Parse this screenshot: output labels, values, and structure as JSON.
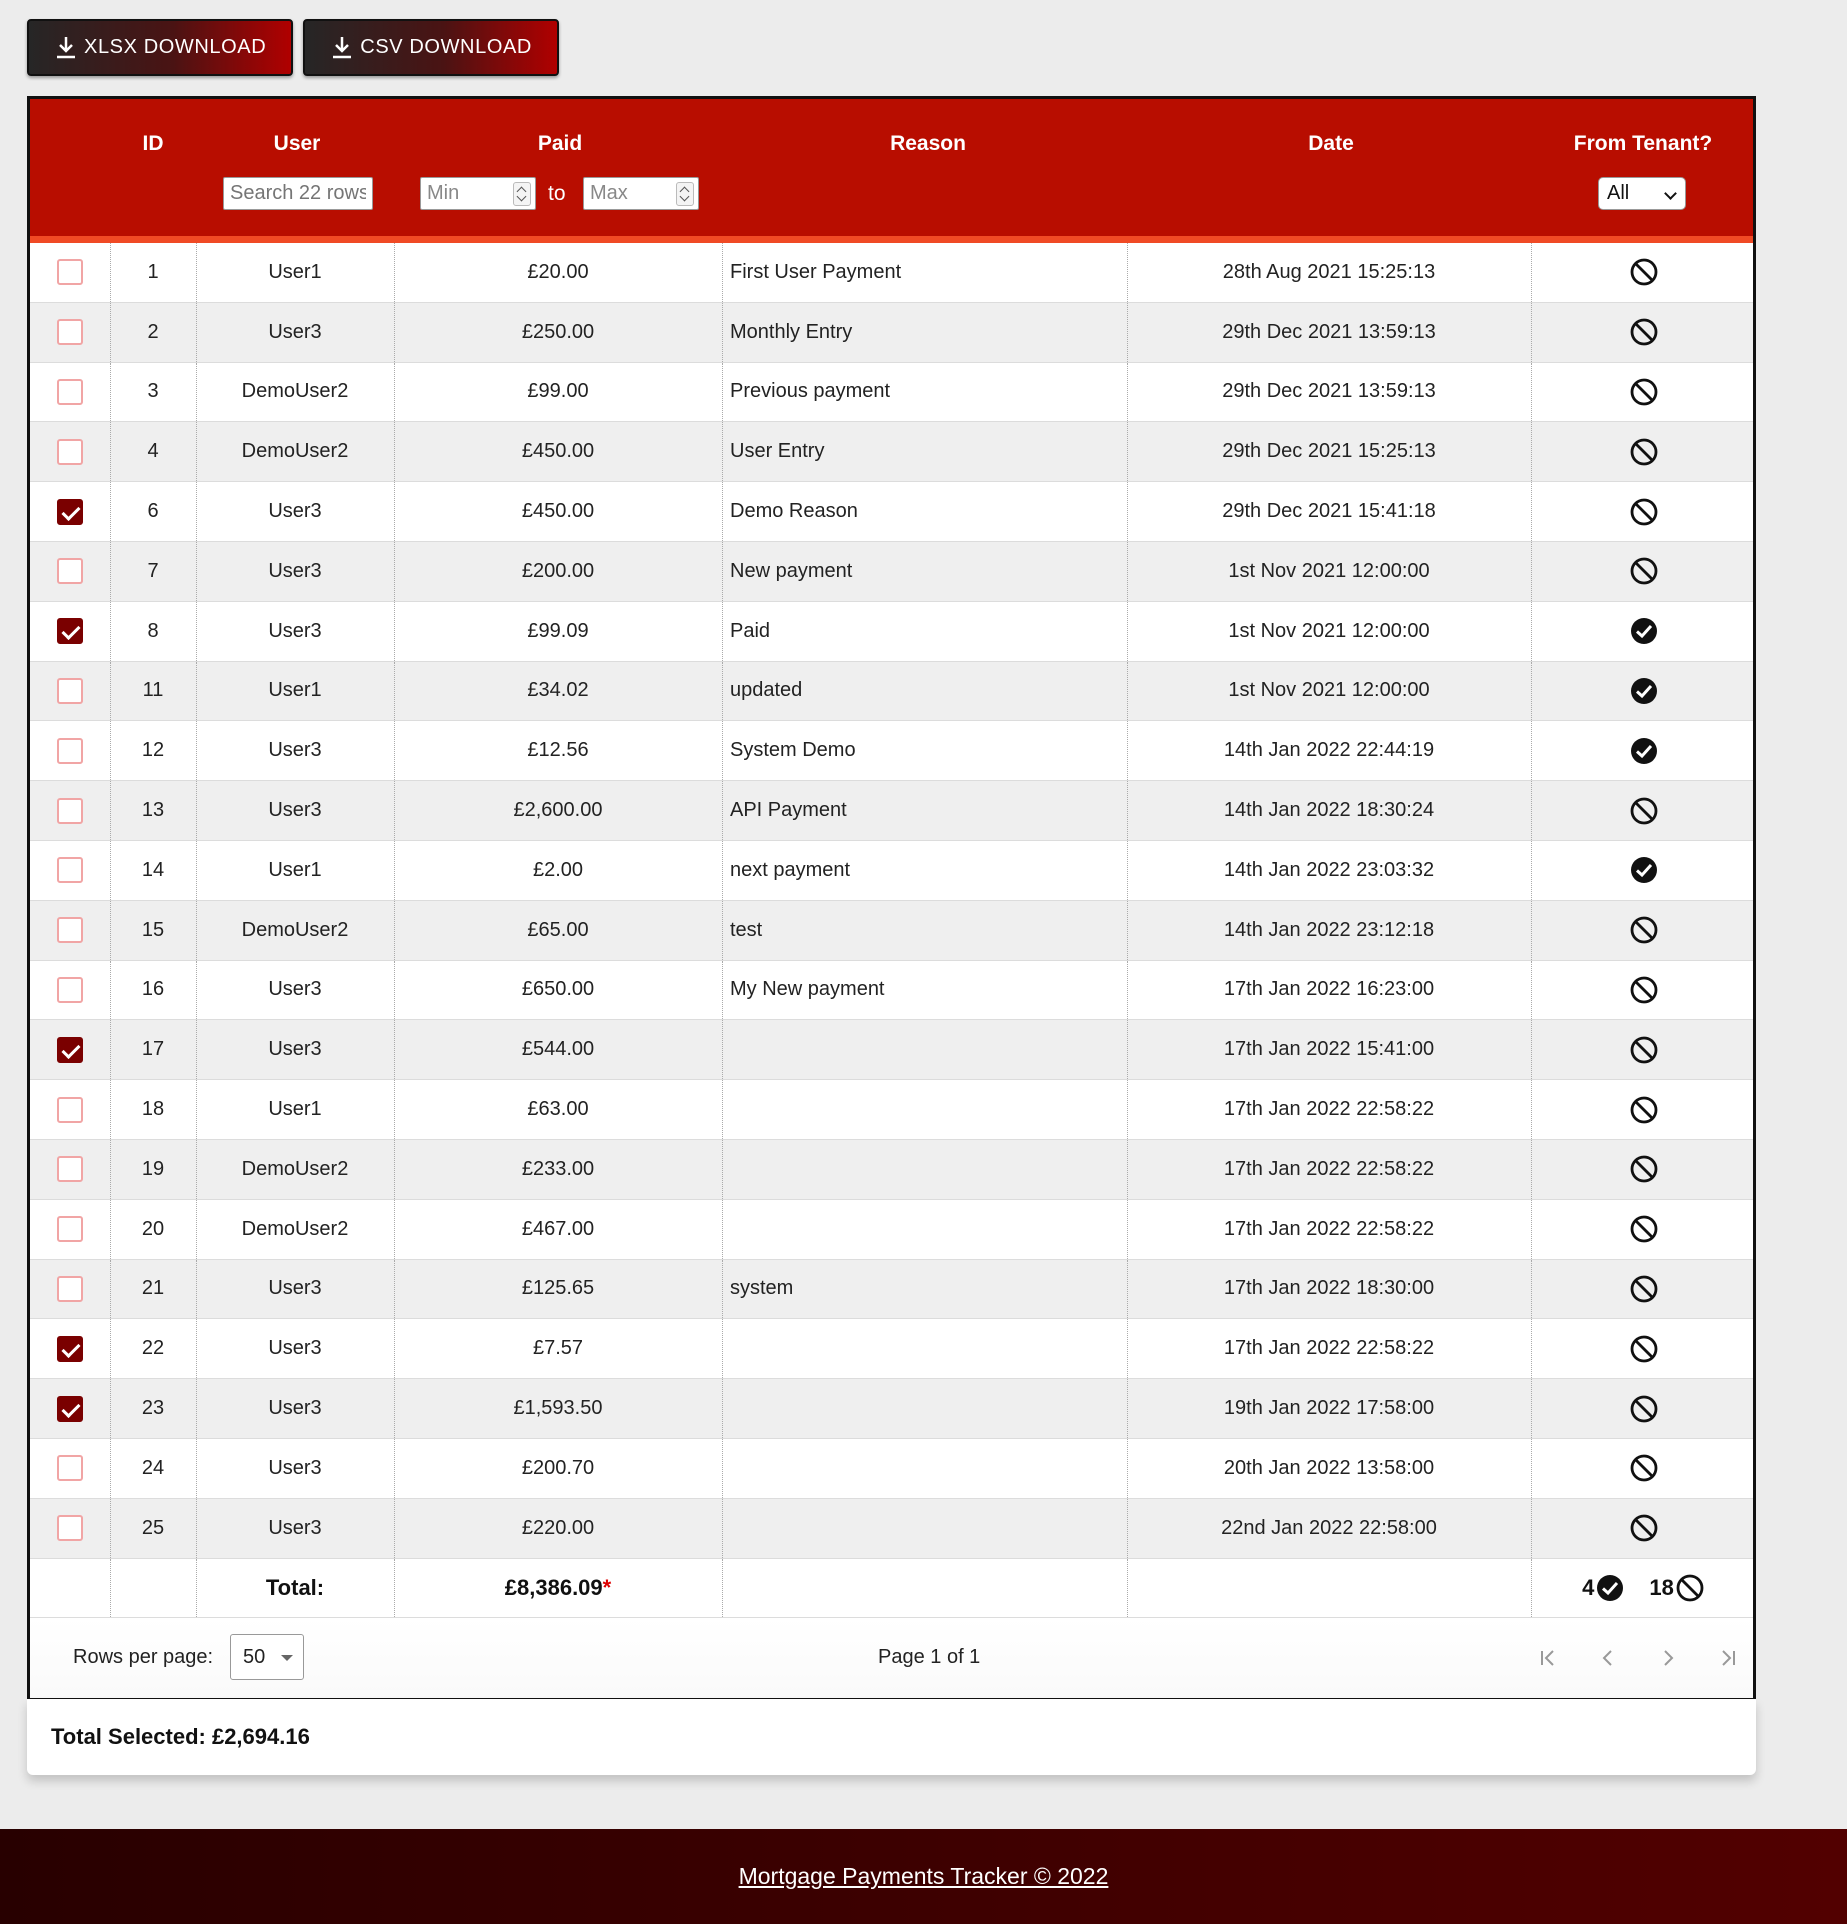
{
  "toolbar": {
    "xlsx_label": "XLSX DOWNLOAD",
    "csv_label": "CSV DOWNLOAD"
  },
  "table": {
    "headers": {
      "id": "ID",
      "user": "User",
      "paid": "Paid",
      "reason": "Reason",
      "date": "Date",
      "tenant": "From Tenant?"
    },
    "filters": {
      "user_placeholder": "Search 22 rows",
      "min_placeholder": "Min",
      "to_label": "to",
      "max_placeholder": "Max",
      "tenant_selected": "All"
    },
    "rows": [
      {
        "checked": false,
        "id": "1",
        "user": "User1",
        "paid": "£20.00",
        "reason": "First User Payment",
        "date": "28th Aug 2021 15:25:13",
        "tenant": false
      },
      {
        "checked": false,
        "id": "2",
        "user": "User3",
        "paid": "£250.00",
        "reason": "Monthly Entry",
        "date": "29th Dec 2021 13:59:13",
        "tenant": false
      },
      {
        "checked": false,
        "id": "3",
        "user": "DemoUser2",
        "paid": "£99.00",
        "reason": "Previous payment",
        "date": "29th Dec 2021 13:59:13",
        "tenant": false
      },
      {
        "checked": false,
        "id": "4",
        "user": "DemoUser2",
        "paid": "£450.00",
        "reason": "User Entry",
        "date": "29th Dec 2021 15:25:13",
        "tenant": false
      },
      {
        "checked": true,
        "id": "6",
        "user": "User3",
        "paid": "£450.00",
        "reason": "Demo Reason",
        "date": "29th Dec 2021 15:41:18",
        "tenant": false
      },
      {
        "checked": false,
        "id": "7",
        "user": "User3",
        "paid": "£200.00",
        "reason": "New payment",
        "date": "1st Nov 2021 12:00:00",
        "tenant": false
      },
      {
        "checked": true,
        "id": "8",
        "user": "User3",
        "paid": "£99.09",
        "reason": "Paid",
        "date": "1st Nov 2021 12:00:00",
        "tenant": true
      },
      {
        "checked": false,
        "id": "11",
        "user": "User1",
        "paid": "£34.02",
        "reason": "updated",
        "date": "1st Nov 2021 12:00:00",
        "tenant": true
      },
      {
        "checked": false,
        "id": "12",
        "user": "User3",
        "paid": "£12.56",
        "reason": "System Demo",
        "date": "14th Jan 2022 22:44:19",
        "tenant": true
      },
      {
        "checked": false,
        "id": "13",
        "user": "User3",
        "paid": "£2,600.00",
        "reason": "API Payment",
        "date": "14th Jan 2022 18:30:24",
        "tenant": false
      },
      {
        "checked": false,
        "id": "14",
        "user": "User1",
        "paid": "£2.00",
        "reason": "next payment",
        "date": "14th Jan 2022 23:03:32",
        "tenant": true
      },
      {
        "checked": false,
        "id": "15",
        "user": "DemoUser2",
        "paid": "£65.00",
        "reason": "test",
        "date": "14th Jan 2022 23:12:18",
        "tenant": false
      },
      {
        "checked": false,
        "id": "16",
        "user": "User3",
        "paid": "£650.00",
        "reason": "My New payment",
        "date": "17th Jan 2022 16:23:00",
        "tenant": false
      },
      {
        "checked": true,
        "id": "17",
        "user": "User3",
        "paid": "£544.00",
        "reason": "",
        "date": "17th Jan 2022 15:41:00",
        "tenant": false
      },
      {
        "checked": false,
        "id": "18",
        "user": "User1",
        "paid": "£63.00",
        "reason": "",
        "date": "17th Jan 2022 22:58:22",
        "tenant": false
      },
      {
        "checked": false,
        "id": "19",
        "user": "DemoUser2",
        "paid": "£233.00",
        "reason": "",
        "date": "17th Jan 2022 22:58:22",
        "tenant": false
      },
      {
        "checked": false,
        "id": "20",
        "user": "DemoUser2",
        "paid": "£467.00",
        "reason": "",
        "date": "17th Jan 2022 22:58:22",
        "tenant": false
      },
      {
        "checked": false,
        "id": "21",
        "user": "User3",
        "paid": "£125.65",
        "reason": "system",
        "date": "17th Jan 2022 18:30:00",
        "tenant": false
      },
      {
        "checked": true,
        "id": "22",
        "user": "User3",
        "paid": "£7.57",
        "reason": "",
        "date": "17th Jan 2022 22:58:22",
        "tenant": false
      },
      {
        "checked": true,
        "id": "23",
        "user": "User3",
        "paid": "£1,593.50",
        "reason": "",
        "date": "19th Jan 2022 17:58:00",
        "tenant": false
      },
      {
        "checked": false,
        "id": "24",
        "user": "User3",
        "paid": "£200.70",
        "reason": "",
        "date": "20th Jan 2022 13:58:00",
        "tenant": false
      },
      {
        "checked": false,
        "id": "25",
        "user": "User3",
        "paid": "£220.00",
        "reason": "",
        "date": "22nd Jan 2022 22:58:00",
        "tenant": false
      }
    ],
    "totals": {
      "label": "Total:",
      "paid": "£8,386.09",
      "asterisk": "*",
      "tenant_yes_count": "4",
      "tenant_no_count": "18"
    }
  },
  "pager": {
    "rows_per_page_label": "Rows per page:",
    "rows_per_page_value": "50",
    "page_info": "Page 1 of 1"
  },
  "selection": {
    "total_selected": "Total Selected: £2,694.16"
  },
  "footer": {
    "text": "Mortgage Payments Tracker © 2022"
  },
  "icons": {
    "download": "download-icon",
    "not_tenant": "ban-icon",
    "tenant": "check-circle-icon",
    "first": "first-page-icon",
    "prev": "prev-page-icon",
    "next": "next-page-icon",
    "last": "last-page-icon"
  },
  "colors": {
    "header_bg": "#b80d00",
    "header_accent": "#f04a25",
    "checkbox_checked": "#7a0000",
    "checkbox_border": "#f1a5a5",
    "footer_bg": "#3d0000",
    "total_asterisk": "#dd0000"
  }
}
